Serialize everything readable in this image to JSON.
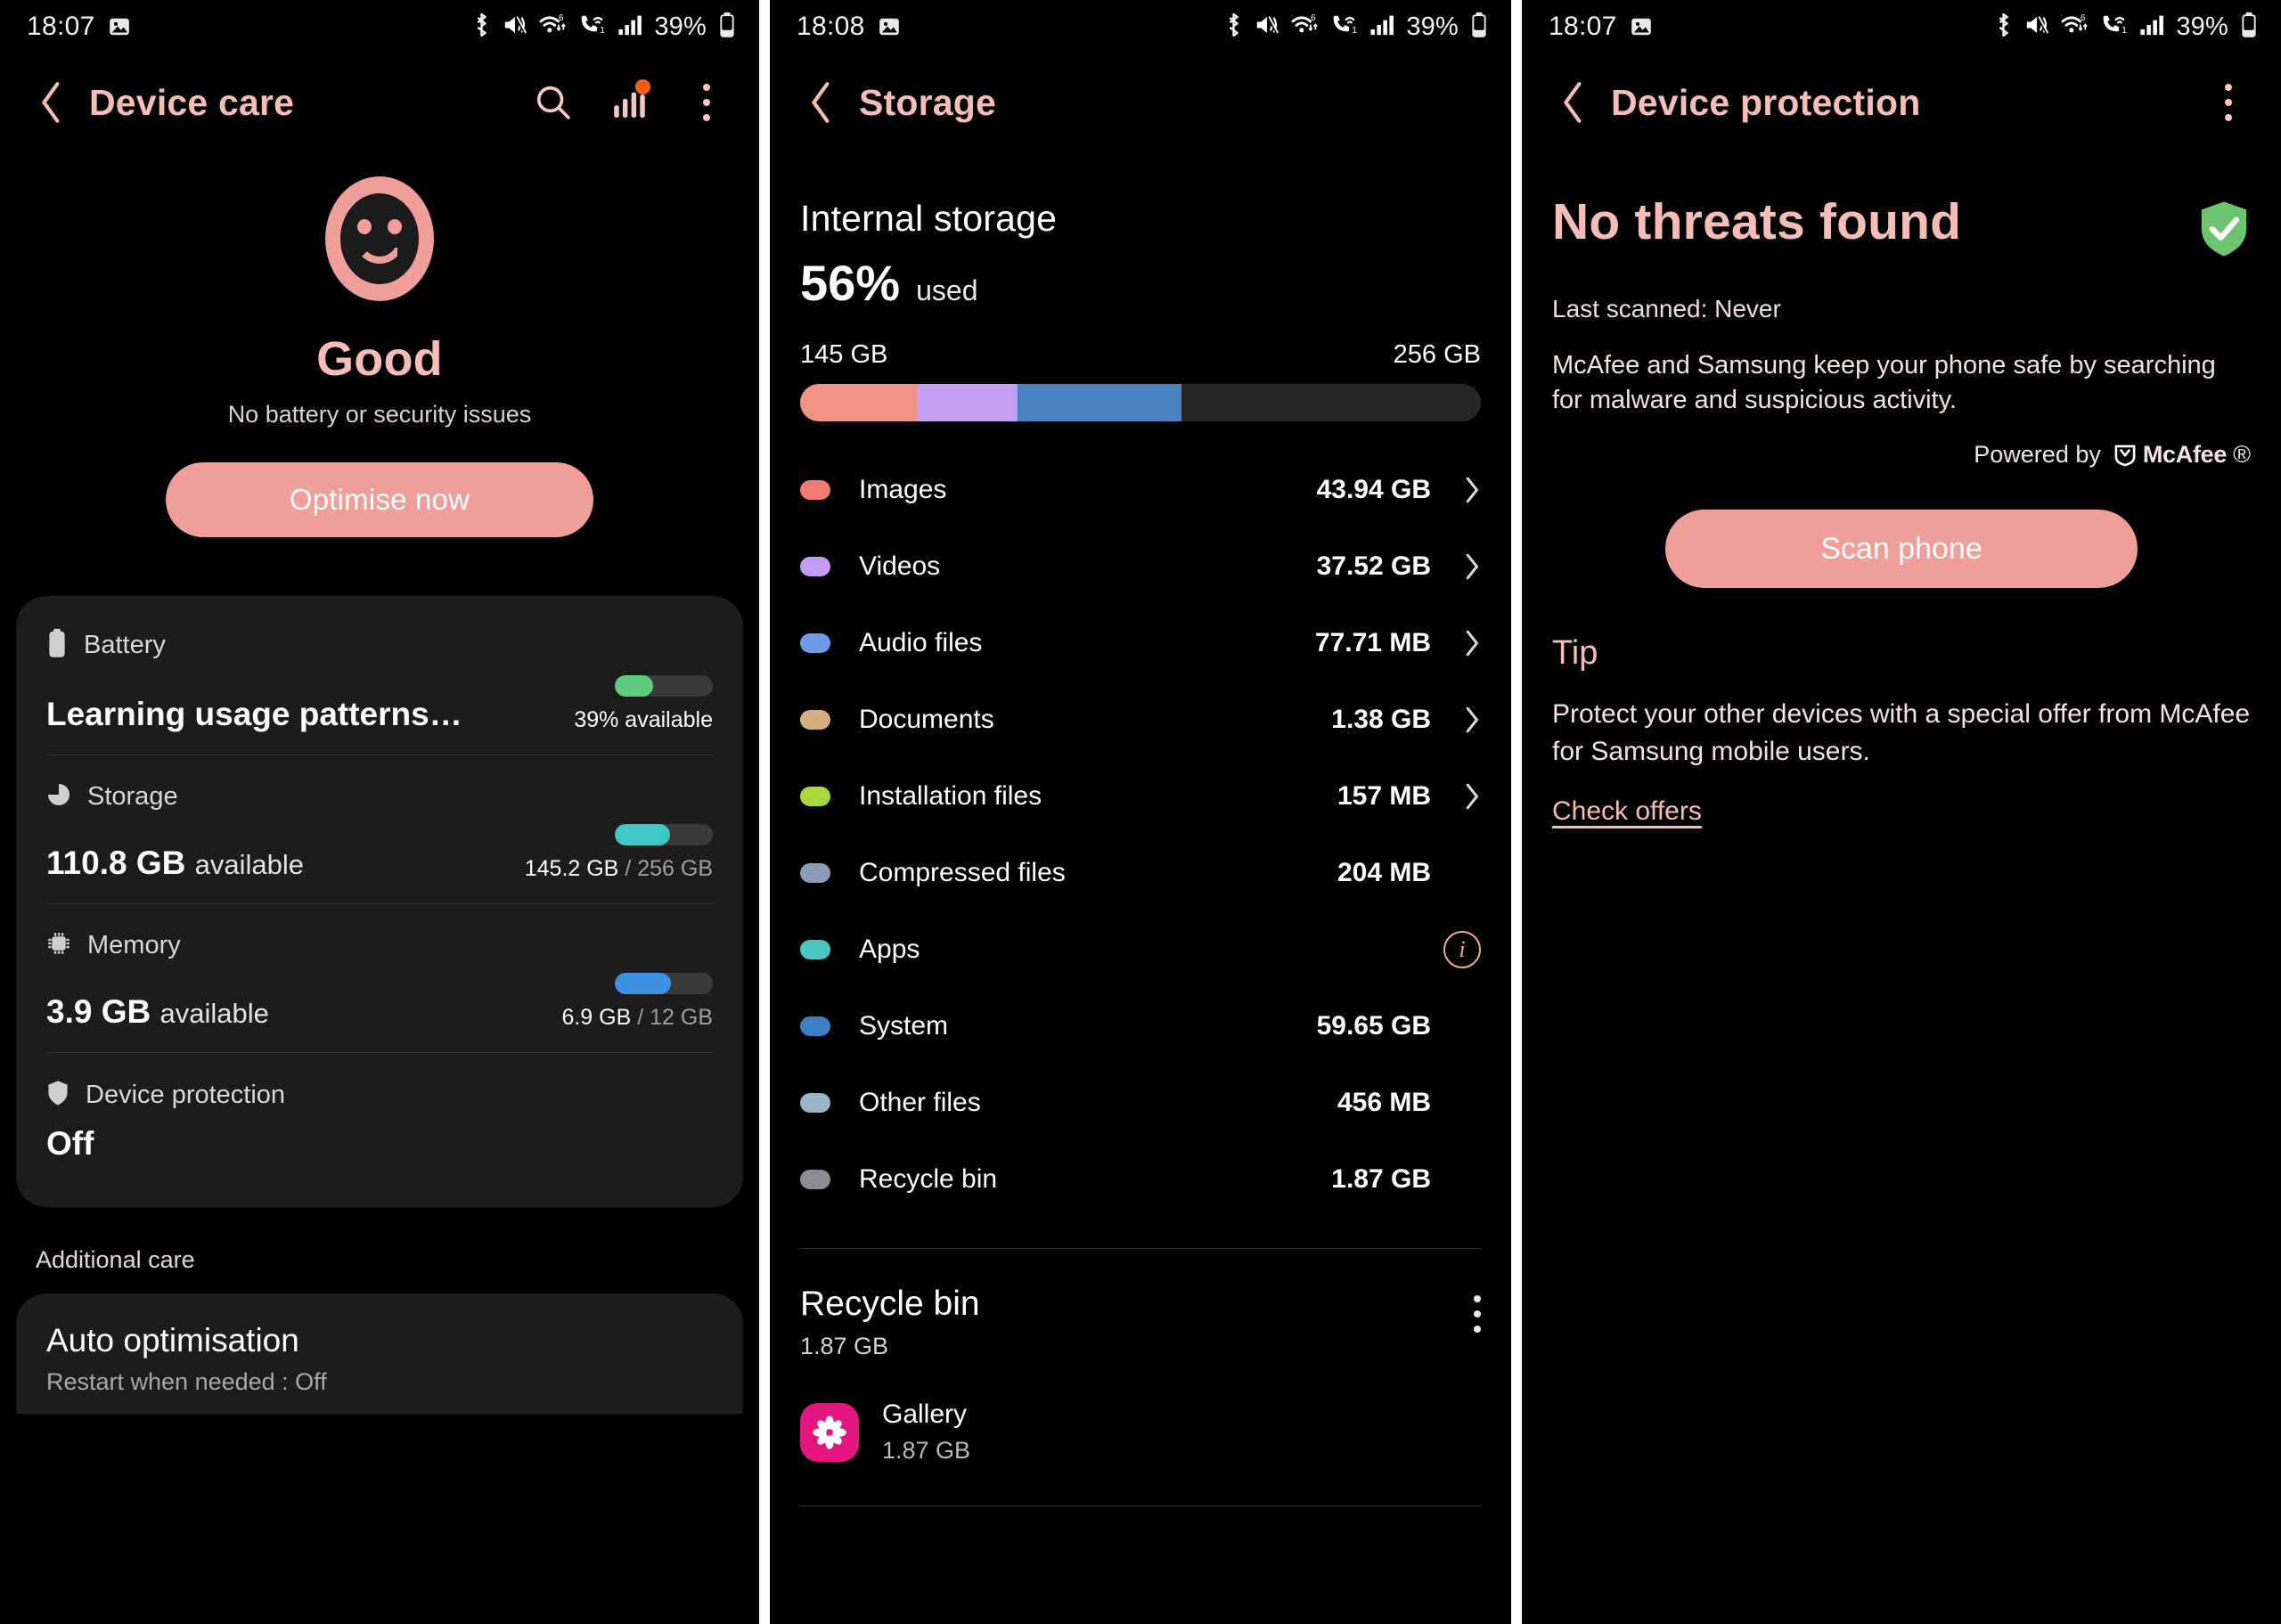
{
  "accent_pink": "#f6bdb6",
  "button_pink": "#ef9e99",
  "panels": [
    {
      "status": {
        "time": "18:07",
        "battery_pct": "39%",
        "icons": [
          "image-icon",
          "bluetooth-icon",
          "vibrate-mute-icon",
          "wifi-6-icon",
          "vowifi-call-icon",
          "signal-bars-icon",
          "battery-icon"
        ]
      },
      "appbar": {
        "title": "Device care",
        "back": "back-arrow-icon",
        "actions": [
          "search-icon",
          "stats-bar-icon",
          "more-options-icon"
        ],
        "badge": true
      },
      "hero": {
        "icon": "smiley-face-icon",
        "title": "Good",
        "subtitle": "No battery or security issues",
        "cta": "Optimise now"
      },
      "card_rows": [
        {
          "icon": "battery-icon",
          "label": "Battery",
          "main": "Learning usage patterns…",
          "main_lite": "",
          "meta": "39% available",
          "meta_dim": "",
          "bar_pct": 39,
          "bar_color": "#5ecb7e"
        },
        {
          "icon": "storage-pie-icon",
          "label": "Storage",
          "main": "110.8 GB",
          "main_lite": "available",
          "meta": "145.2 GB",
          "meta_dim": " / 256 GB",
          "bar_pct": 56,
          "bar_color": "#3fc6c9"
        },
        {
          "icon": "memory-chip-icon",
          "label": "Memory",
          "main": "3.9 GB",
          "main_lite": "available",
          "meta": "6.9 GB",
          "meta_dim": " / 12 GB",
          "bar_pct": 57,
          "bar_color": "#3d8fe0"
        },
        {
          "icon": "shield-icon",
          "label": "Device protection",
          "off_value": "Off"
        }
      ],
      "section_label": "Additional care",
      "auto": {
        "title": "Auto optimisation",
        "subtitle": "Restart when needed : Off"
      }
    },
    {
      "status": {
        "time": "18:08",
        "battery_pct": "39%"
      },
      "appbar": {
        "title": "Storage"
      },
      "internal": {
        "title": "Internal storage",
        "percent": "56%",
        "used_label": "used",
        "min": "145 GB",
        "max": "256 GB"
      },
      "categories": [
        {
          "name": "Images",
          "value": "43.94 GB",
          "color": "#ef7a6d",
          "chevron": true,
          "info": false
        },
        {
          "name": "Videos",
          "value": "37.52 GB",
          "color": "#c39bf2",
          "chevron": true,
          "info": false
        },
        {
          "name": "Audio files",
          "value": "77.71 MB",
          "color": "#6e9ae8",
          "chevron": true,
          "info": false
        },
        {
          "name": "Documents",
          "value": "1.38 GB",
          "color": "#d6ae82",
          "chevron": true,
          "info": false
        },
        {
          "name": "Installation files",
          "value": "157 MB",
          "color": "#a7d93c",
          "chevron": true,
          "info": false
        },
        {
          "name": "Compressed files",
          "value": "204 MB",
          "color": "#8b9bb8",
          "chevron": false,
          "info": false
        },
        {
          "name": "Apps",
          "value": "",
          "color": "#4cc8c0",
          "chevron": false,
          "info": true
        },
        {
          "name": "System",
          "value": "59.65 GB",
          "color": "#3d7fc4",
          "chevron": false,
          "info": false
        },
        {
          "name": "Other files",
          "value": "456 MB",
          "color": "#9ab4c9",
          "chevron": false,
          "info": false
        },
        {
          "name": "Recycle bin",
          "value": "1.87 GB",
          "color": "#8d8d96",
          "chevron": false,
          "info": false
        }
      ],
      "recycle": {
        "title": "Recycle bin",
        "size": "1.87 GB",
        "menu": "more-options-icon",
        "app": {
          "name": "Gallery",
          "size": "1.87 GB",
          "icon": "gallery-flower-icon"
        }
      }
    },
    {
      "status": {
        "time": "18:07",
        "battery_pct": "39%"
      },
      "appbar": {
        "title": "Device protection"
      },
      "result": {
        "title": "No threats found",
        "shield": "shield-check-icon",
        "last_scanned": "Last scanned: Never",
        "description": "McAfee and Samsung keep your phone safe by searching for malware and suspicious activity.",
        "powered_by": "Powered by",
        "brand": "McAfee",
        "scan_button": "Scan phone"
      },
      "tip": {
        "heading": "Tip",
        "body": "Protect your other devices with a special offer from McAfee for Samsung mobile users.",
        "link": "Check offers"
      }
    }
  ],
  "chart_data": {
    "type": "bar",
    "title": "Internal storage usage by category",
    "categories": [
      "Images",
      "Videos",
      "Audio files",
      "Documents",
      "Installation files",
      "Compressed files",
      "Apps",
      "System",
      "Other files",
      "Recycle bin"
    ],
    "values_gb": [
      43.94,
      37.52,
      0.0777,
      1.38,
      0.157,
      0.204,
      null,
      59.65,
      0.456,
      1.87
    ],
    "total_gb": 256,
    "used_gb": 145,
    "used_percent": 56,
    "free_gb": 110.8,
    "segment_percent": [
      17.2,
      14.7,
      24.1
    ],
    "segment_colors": [
      "#ef9384",
      "#c49ef2",
      "#4a82bf"
    ],
    "ylabel": "GB",
    "legend_position": "inline"
  }
}
